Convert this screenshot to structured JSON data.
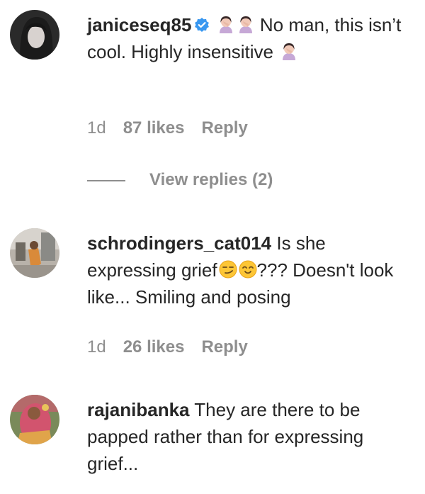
{
  "comments": [
    {
      "username": "janiceseq85",
      "verified": true,
      "emoji_before": [
        "woman-facepalming-emoji",
        "woman-facepalming-emoji"
      ],
      "text": "No man, this isn’t cool. Highly insensitive",
      "emoji_after": [
        "woman-facepalming-emoji"
      ],
      "time": "1d",
      "likes": "87 likes",
      "reply_label": "Reply",
      "view_replies": "View replies (2)"
    },
    {
      "username": "schrodingers_cat014",
      "text_part1": "Is she expressing grief",
      "emoji_mid": [
        "smirking-face-emoji",
        "smiling-closed-eyes-emoji"
      ],
      "text_part2": "??? Doesn't look like... Smiling and posing",
      "time": "1d",
      "likes": "26 likes",
      "reply_label": "Reply"
    },
    {
      "username": "rajanibanka",
      "text": "They are there to be papped rather than for expressing grief..."
    }
  ],
  "colors": {
    "text": "#262626",
    "secondary": "#8e8e8e",
    "verified": "#3897f0"
  }
}
